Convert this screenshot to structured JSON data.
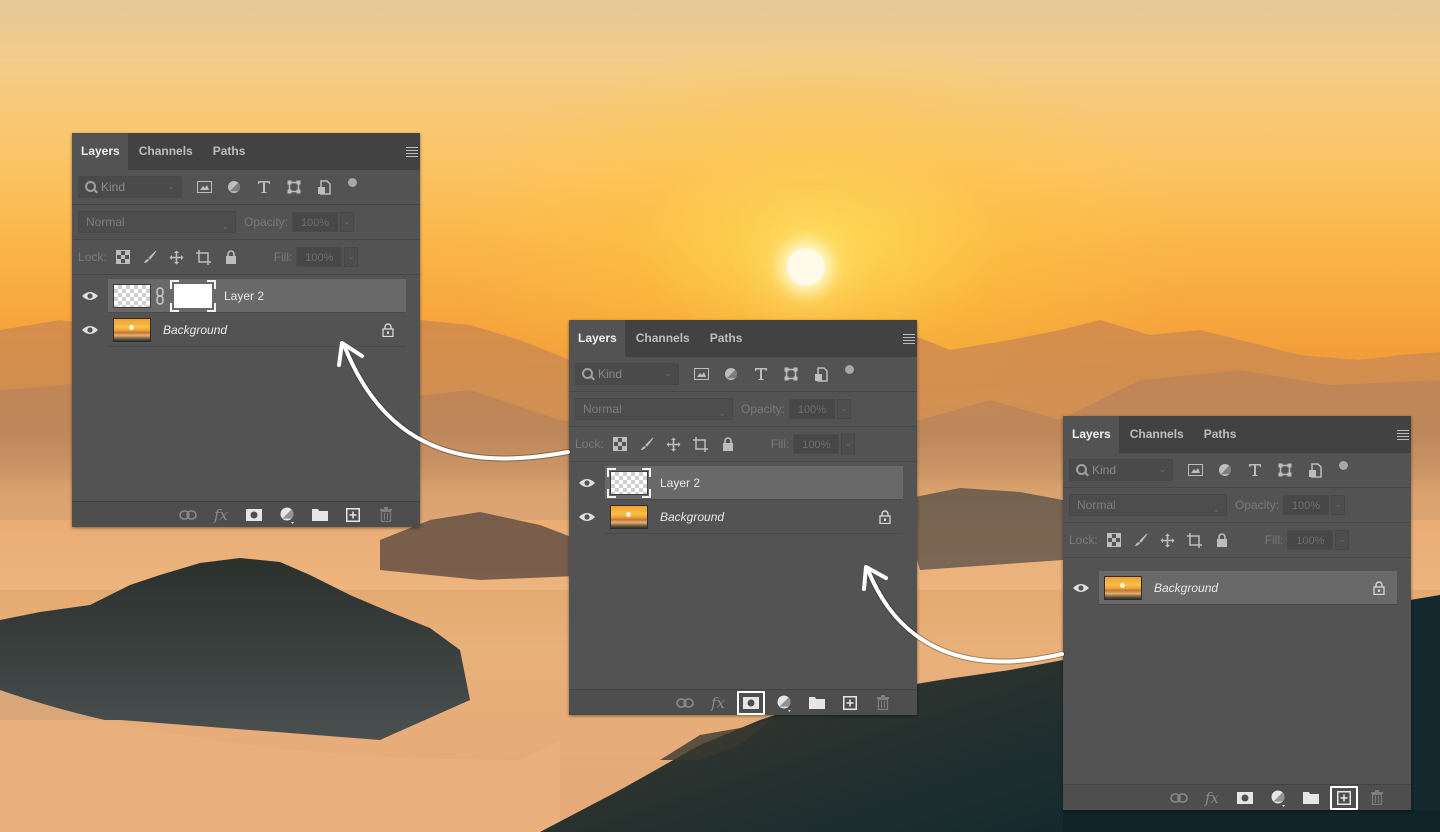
{
  "scene": {
    "description": "Sunset over misty mountains background photo",
    "colors": {
      "sky_top": "#e7c89a",
      "sky_mid": "#fbb84c",
      "sky_low": "#ef9a3a",
      "mountain_dark": "#2b3535",
      "sun": "#fffbe8"
    }
  },
  "panels": [
    {
      "id": "panel-left",
      "tabs": [
        "Layers",
        "Channels",
        "Paths"
      ],
      "active_tab": "Layers",
      "filter": {
        "placeholder": "Kind"
      },
      "blend_mode": "Normal",
      "opacity_label": "Opacity:",
      "opacity_value": "100%",
      "lock_label": "Lock:",
      "fill_label": "Fill:",
      "fill_value": "100%",
      "layers": [
        {
          "name": "Layer 2",
          "visible": true,
          "selected": true,
          "has_mask": true,
          "thumb": "transparent"
        },
        {
          "name": "Background",
          "visible": true,
          "selected": false,
          "locked": true,
          "thumb": "photo"
        }
      ],
      "footer_highlight": null
    },
    {
      "id": "panel-middle",
      "tabs": [
        "Layers",
        "Channels",
        "Paths"
      ],
      "active_tab": "Layers",
      "filter": {
        "placeholder": "Kind"
      },
      "blend_mode": "Normal",
      "opacity_label": "Opacity:",
      "opacity_value": "100%",
      "lock_label": "Lock:",
      "fill_label": "Fill:",
      "fill_value": "100%",
      "layers": [
        {
          "name": "Layer 2",
          "visible": true,
          "selected": true,
          "has_mask": false,
          "thumb": "transparent"
        },
        {
          "name": "Background",
          "visible": true,
          "selected": false,
          "locked": true,
          "thumb": "photo"
        }
      ],
      "footer_highlight": "add-layer-mask"
    },
    {
      "id": "panel-right",
      "tabs": [
        "Layers",
        "Channels",
        "Paths"
      ],
      "active_tab": "Layers",
      "filter": {
        "placeholder": "Kind"
      },
      "blend_mode": "Normal",
      "opacity_label": "Opacity:",
      "opacity_value": "100%",
      "lock_label": "Lock:",
      "fill_label": "Fill:",
      "fill_value": "100%",
      "layers": [
        {
          "name": "Background",
          "visible": true,
          "selected": true,
          "locked": true,
          "thumb": "photo"
        }
      ],
      "footer_highlight": "create-new-layer"
    }
  ],
  "footer_icons": [
    "link-layers",
    "fx-layer-style",
    "add-layer-mask",
    "adjustment-layer",
    "new-group",
    "create-new-layer",
    "delete-layer"
  ],
  "filter_icons": [
    "pixel-filter",
    "adjustment-filter",
    "type-filter",
    "shape-filter",
    "smart-object-filter"
  ],
  "lock_icons": [
    "lock-transparent-pixels",
    "lock-image-pixels",
    "lock-position",
    "lock-artboard",
    "lock-all"
  ],
  "arrows": [
    {
      "from": "panel-right",
      "to": "panel-middle"
    },
    {
      "from": "panel-middle",
      "to": "panel-left"
    }
  ]
}
